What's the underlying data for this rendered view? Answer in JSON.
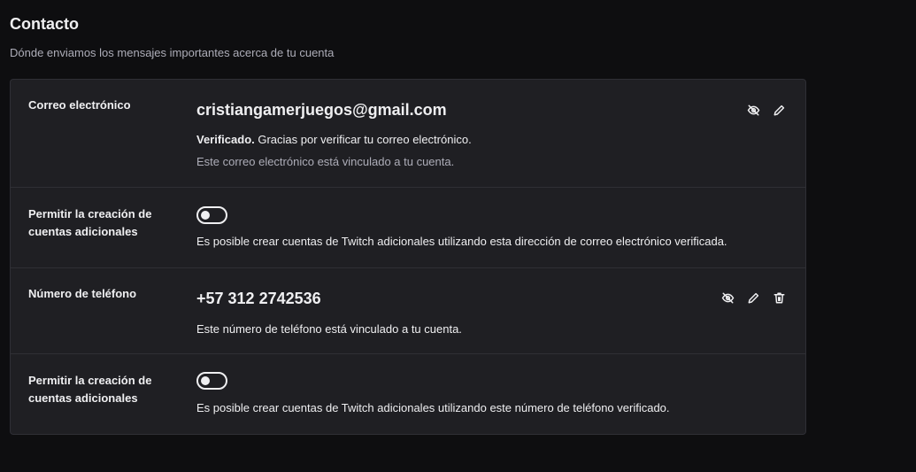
{
  "header": {
    "title": "Contacto",
    "subtitle": "Dónde enviamos los mensajes importantes acerca de tu cuenta"
  },
  "email": {
    "label": "Correo electrónico",
    "value": "cristiangamerjuegos@gmail.com",
    "verified_bold": "Verificado.",
    "verified_text": " Gracias por verificar tu correo electrónico.",
    "linked_text": "Este correo electrónico está vinculado a tu cuenta."
  },
  "email_extra": {
    "label": "Permitir la creación de cuentas adicionales",
    "enabled": false,
    "description": "Es posible crear cuentas de Twitch adicionales utilizando esta dirección de correo electrónico verificada."
  },
  "phone": {
    "label": "Número de teléfono",
    "value": "+57 312 2742536",
    "linked_text": "Este número de teléfono está vinculado a tu cuenta."
  },
  "phone_extra": {
    "label": "Permitir la creación de cuentas adicionales",
    "enabled": false,
    "description": "Es posible crear cuentas de Twitch adicionales utilizando este número de teléfono verificado."
  },
  "icons": [
    "hide-icon",
    "edit-icon",
    "trash-icon"
  ],
  "colors": {
    "background": "#0e0e10",
    "card": "#1f1f23",
    "border": "#2f2f35",
    "text": "#efeff1",
    "muted": "#adadb8"
  }
}
